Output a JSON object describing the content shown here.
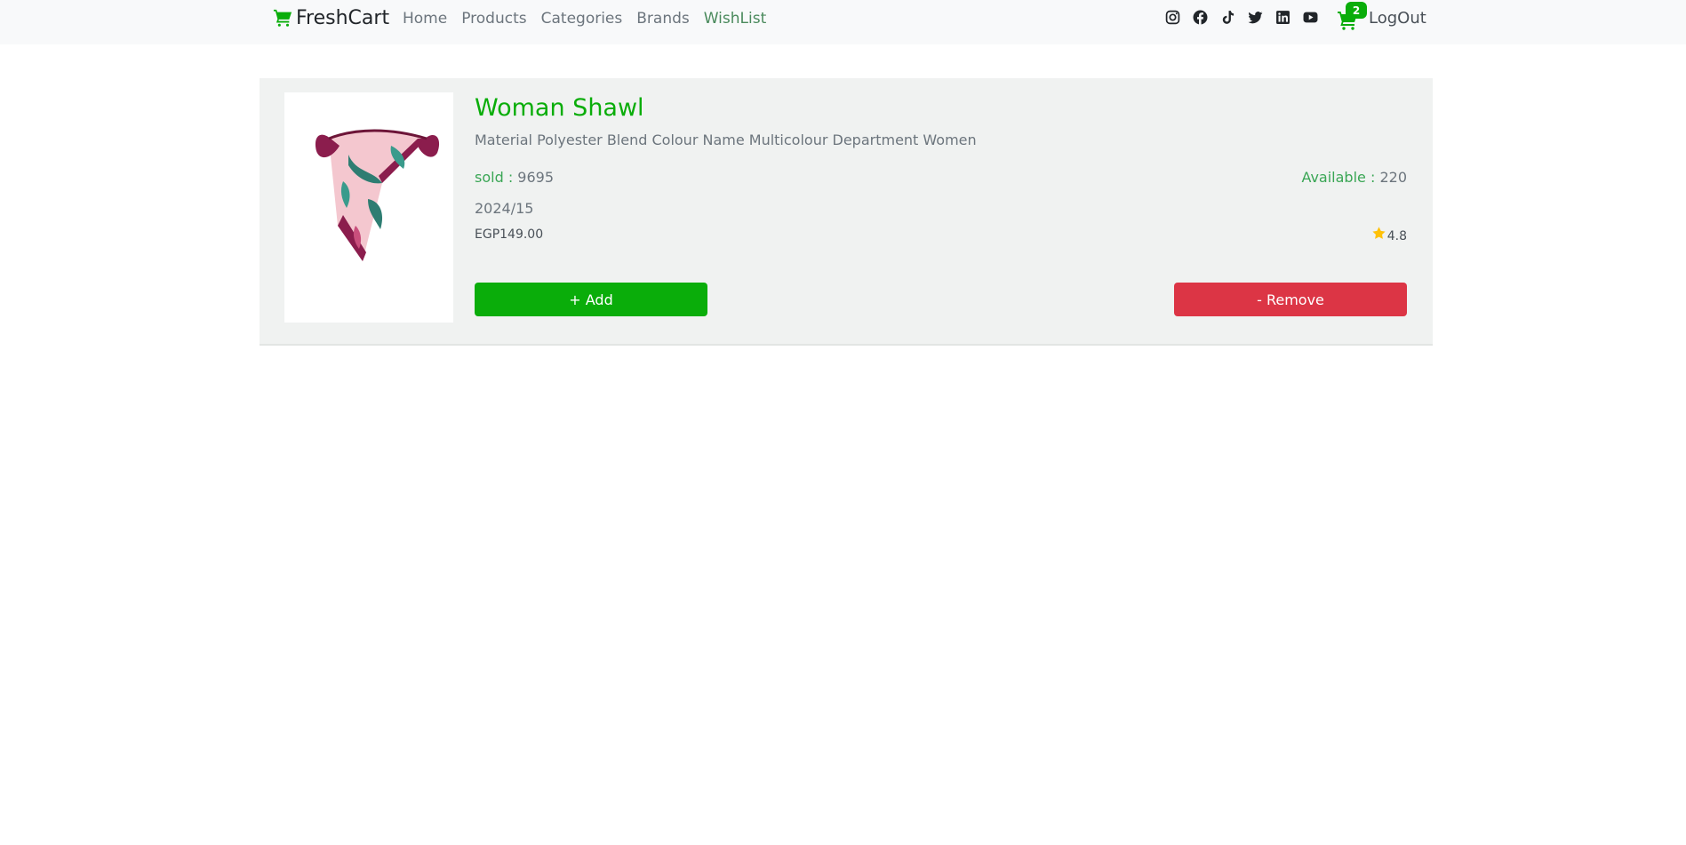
{
  "navbar": {
    "brand": "FreshCart",
    "links": [
      "Home",
      "Products",
      "Categories",
      "Brands",
      "WishList"
    ],
    "active_link": "WishList",
    "social_icons": [
      "instagram-icon",
      "facebook-icon",
      "tiktok-icon",
      "twitter-icon",
      "linkedin-icon",
      "youtube-icon"
    ],
    "cart_count": "2",
    "logout": "LogOut"
  },
  "product": {
    "title": "Woman Shawl",
    "description": "Material Polyester Blend Colour Name Multicolour Department Women",
    "sold_label": "sold :",
    "sold_value": "9695",
    "available_label": "Available :",
    "available_value": "220",
    "date": "2024/15",
    "price": "EGP149.00",
    "rating": "4.8",
    "add_label": "+ Add",
    "remove_label": "- Remove"
  },
  "colors": {
    "accent": "#0aad0a",
    "danger": "#dc3545",
    "star": "#ffc107"
  }
}
